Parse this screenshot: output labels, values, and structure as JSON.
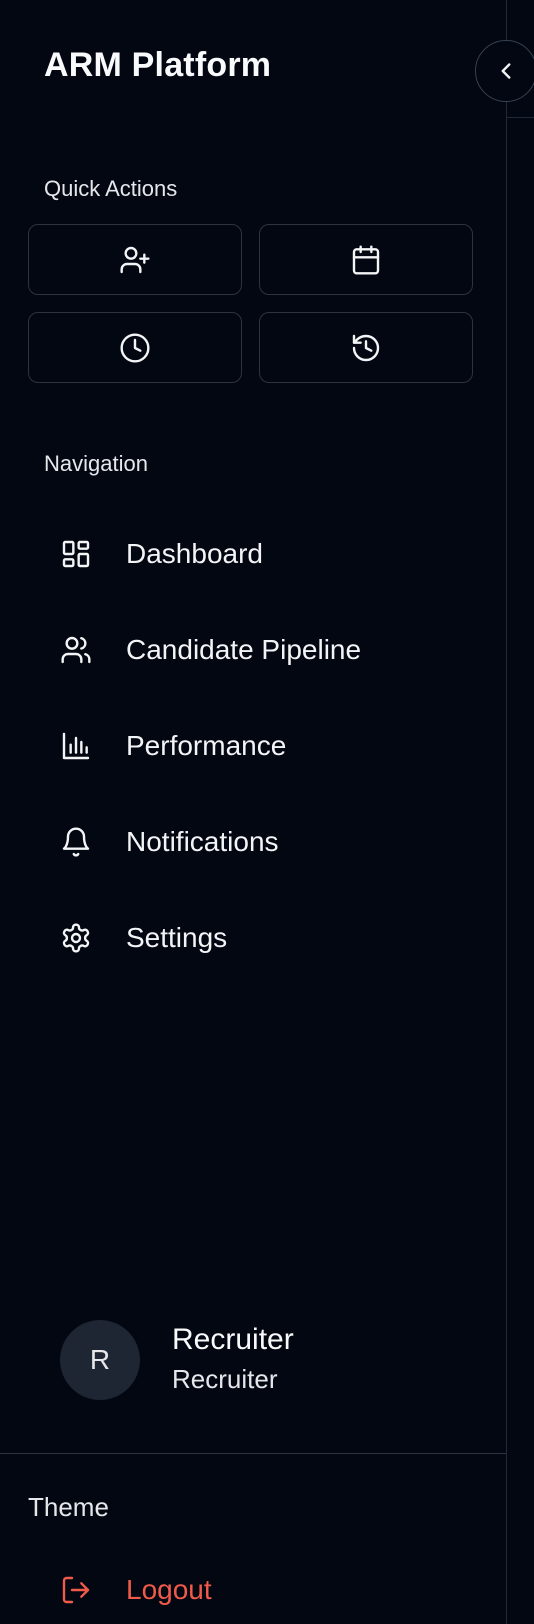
{
  "app": {
    "title": "ARM Platform"
  },
  "quick_actions": {
    "label": "Quick Actions",
    "buttons": [
      {
        "icon": "user-plus-icon"
      },
      {
        "icon": "calendar-icon"
      },
      {
        "icon": "clock-icon"
      },
      {
        "icon": "history-icon"
      }
    ]
  },
  "navigation": {
    "label": "Navigation",
    "items": [
      {
        "label": "Dashboard",
        "icon": "dashboard-grid-icon"
      },
      {
        "label": "Candidate Pipeline",
        "icon": "users-icon"
      },
      {
        "label": "Performance",
        "icon": "bar-chart-icon"
      },
      {
        "label": "Notifications",
        "icon": "bell-icon"
      },
      {
        "label": "Settings",
        "icon": "gear-icon"
      }
    ]
  },
  "user": {
    "initial": "R",
    "name": "Recruiter",
    "role": "Recruiter"
  },
  "footer": {
    "theme_label": "Theme",
    "logout_label": "Logout"
  },
  "colors": {
    "background": "#030712",
    "border": "#2d3340",
    "logout": "#ef5a4a",
    "avatar_bg": "#1e2533"
  }
}
